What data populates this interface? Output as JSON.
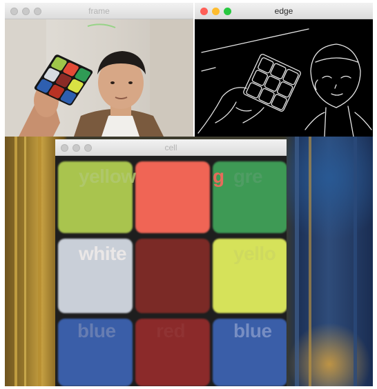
{
  "windows": {
    "frame": {
      "title": "frame"
    },
    "edge": {
      "title": "edge"
    },
    "cell": {
      "title": "cell"
    }
  },
  "colors": {
    "close_red": "#ff5f57",
    "minimize_yellow": "#febc2e",
    "zoom_green": "#28c840"
  },
  "cube_grid": {
    "cells": [
      {
        "color": "#a9c44e"
      },
      {
        "color": "#f06555"
      },
      {
        "color": "#3e9a55"
      },
      {
        "color": "#c9cfd8"
      },
      {
        "color": "#7b2a26"
      },
      {
        "color": "#d6e25a"
      },
      {
        "color": "#3a5ea8"
      },
      {
        "color": "#8b2a2a"
      },
      {
        "color": "#3a5ea8"
      }
    ],
    "labels": {
      "top_left": "yellow",
      "top_middle": "g",
      "top_right": "gre",
      "middle_left": "white",
      "middle_right": "yello",
      "bottom_left": "blue",
      "bottom_middle": "red",
      "bottom_right": "blue"
    }
  }
}
